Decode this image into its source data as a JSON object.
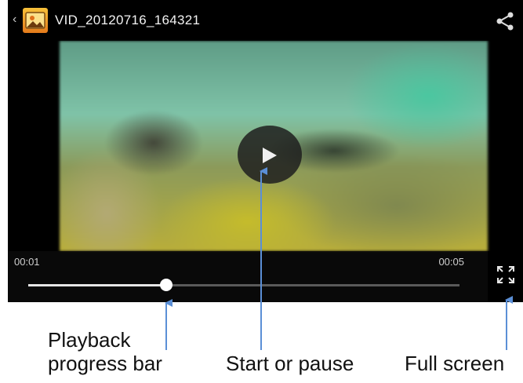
{
  "video": {
    "title": "VID_20120716_164321",
    "current_time": "00:01",
    "total_time": "00:05",
    "progress_fraction": 0.32
  },
  "icons": {
    "back": "chevron-left-icon",
    "gallery": "gallery-app-icon",
    "share": "share-icon",
    "play": "play-icon",
    "fullscreen": "fullscreen-icon"
  },
  "annotations": {
    "progress_line1": "Playback",
    "progress_line2": "progress bar",
    "play": "Start or pause",
    "fullscreen": "Full screen"
  },
  "colors": {
    "annotation_arrow": "#5b8fd6",
    "progress_fill": "#e6e6e6"
  }
}
